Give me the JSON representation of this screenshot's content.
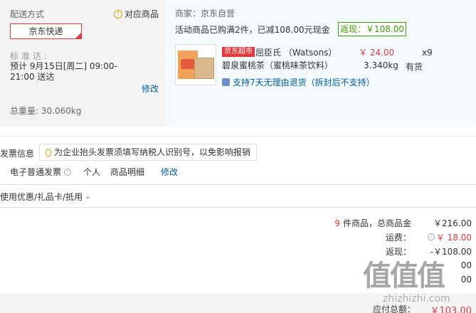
{
  "shipping": {
    "title": "配送方式",
    "match_link": "对应商品",
    "option": "京东快递",
    "std_label": "标准达:",
    "eta": "预计 9月15日[周二] 09:00-21:00 送达",
    "edit": "修改",
    "total_weight": "总重量: 30.060kg"
  },
  "order": {
    "seller": "商家：京东自营",
    "promo": "活动商品已购满2件，已减108.00元现金",
    "rebate": "返现：￥108.00",
    "badge": "京东超市",
    "product_line1": "屈臣氏 （Watsons）",
    "product_line2": "碧泉蜜桃茶（蜜桃味茶饮料）",
    "price": "￥ 24.00",
    "qty": "x9",
    "weight": "3.340kg",
    "stock": "有货",
    "return_policy": "支持7天无理由退货（拆封后不支持）"
  },
  "invoice": {
    "title": "发票信息",
    "tip": "为企业抬头发票须填写纳税人识别号，以免影响报销",
    "type": "电子普通发票",
    "person": "个人",
    "detail": "商品明细",
    "edit": "修改"
  },
  "coupon": {
    "label": "使用优惠/礼品卡/抵用"
  },
  "summary": {
    "count": "9",
    "count_suffix": "件商品，总商品金",
    "goods_total": "￥216.00",
    "freight_label": "运费：",
    "freight": "￥ 18.00",
    "rebate_label": "返现：",
    "rebate": "-￥108.00",
    "row4_value": "00",
    "row5_value": "00",
    "total_label": "应付总额：",
    "total": "￥103.00"
  },
  "watermark": {
    "text": "值值值",
    "sub": "zhizhizhi.com"
  },
  "colors": {
    "accent_red": "#e4393c",
    "link_blue": "#005ea7",
    "rebate_green": "#3aa000"
  }
}
